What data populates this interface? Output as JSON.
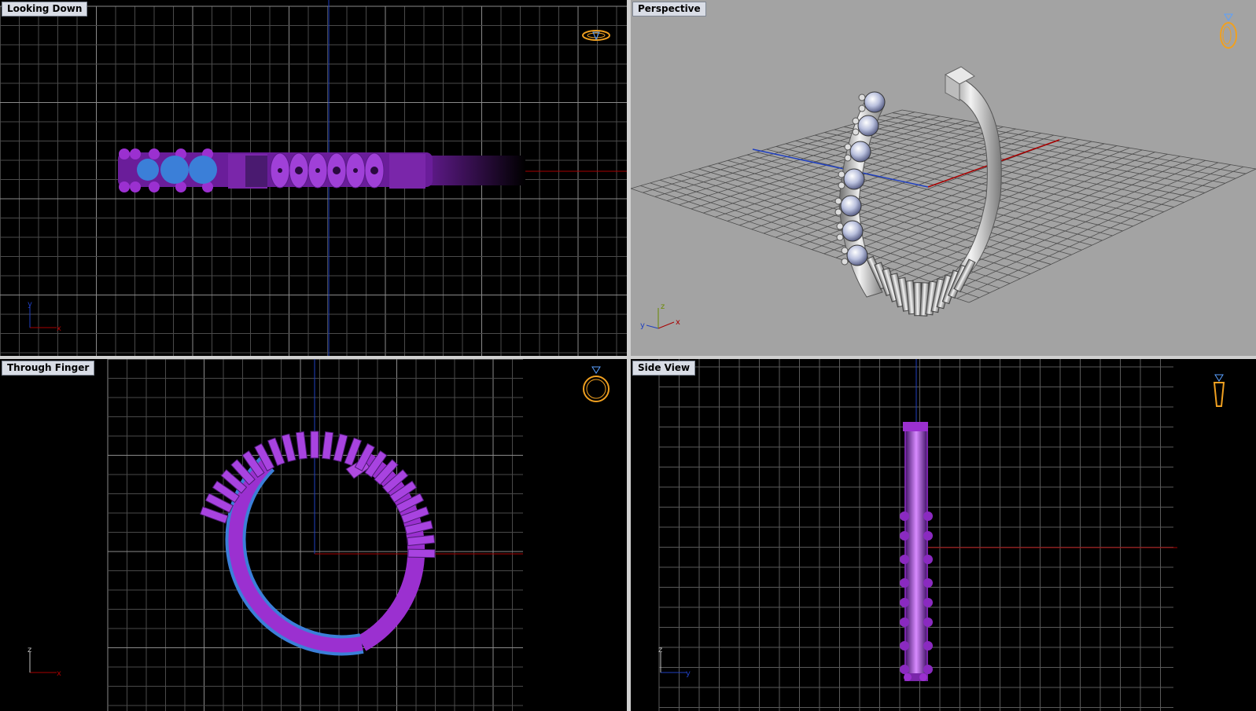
{
  "viewports": {
    "top": {
      "label": "Looking Down"
    },
    "persp": {
      "label": "Perspective"
    },
    "front": {
      "label": "Through Finger"
    },
    "right": {
      "label": "Side View"
    }
  },
  "axes": {
    "top": {
      "h": "x",
      "v": "y"
    },
    "persp": {
      "a": "z",
      "b": "y",
      "c": "x"
    },
    "front": {
      "h": "x",
      "v": "z"
    },
    "right": {
      "h": "y",
      "v": "z"
    }
  },
  "colors": {
    "grid_major": "#6f6f6f",
    "grid_minor": "#3a3a3a",
    "x_axis": "#a80000",
    "y_axis": "#1f3fbf",
    "z_axis": "#0030c0",
    "ring_purple": "#9b30d0",
    "ring_dark": "#4a1a70",
    "ring_silver": "#d0d0d0",
    "gem_blue": "#3b7fd8",
    "label_bg": "#d9dde6",
    "widget_orange": "#f0a020"
  },
  "icons": {
    "top_widget": "ring-top-icon",
    "persp_widget": "ring-perspective-icon",
    "front_widget": "ring-front-icon",
    "right_widget": "ring-side-icon"
  }
}
